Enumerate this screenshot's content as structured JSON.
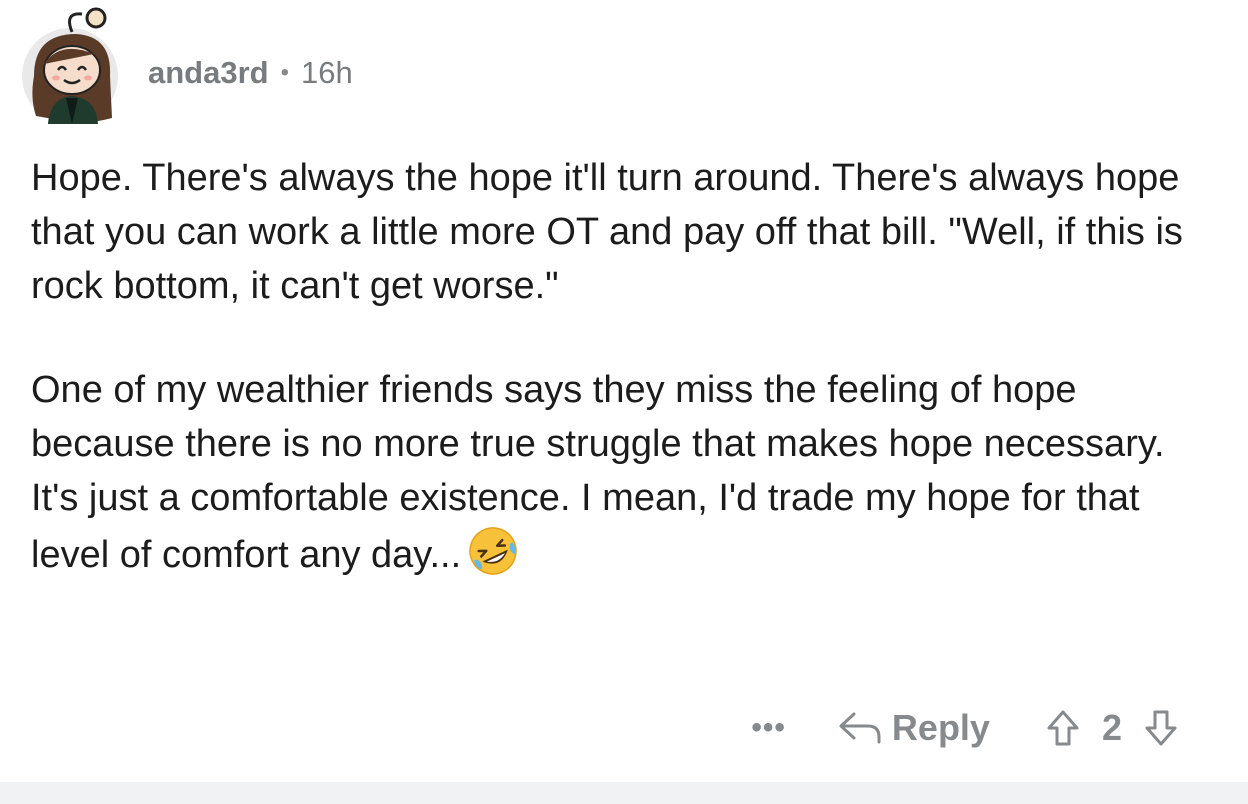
{
  "comment": {
    "author": "anda3rd",
    "separator": "•",
    "age": "16h",
    "paragraphs": [
      "Hope. There's always the hope it'll turn around. There's always hope that you can work a little more OT and pay off that bill. \"Well, if this is rock bottom, it can't get worse.\"",
      "One of my wealthier friends says they miss the feeling of hope because there is no more true struggle that makes hope necessary. It's just a comfortable existence. I mean, I'd trade my hope for that level of comfort any day..."
    ],
    "emoji": "rolling-on-floor-laughing"
  },
  "actions": {
    "more_label": "•••",
    "reply_label": "Reply",
    "score": "2"
  },
  "icons": {
    "reply": "reply-arrow-icon",
    "upvote": "upvote-arrow-icon",
    "downvote": "downvote-arrow-icon"
  },
  "colors": {
    "text": "#1c1c1c",
    "meta": "#787c7e",
    "footer_strip": "#f0f2f4"
  }
}
